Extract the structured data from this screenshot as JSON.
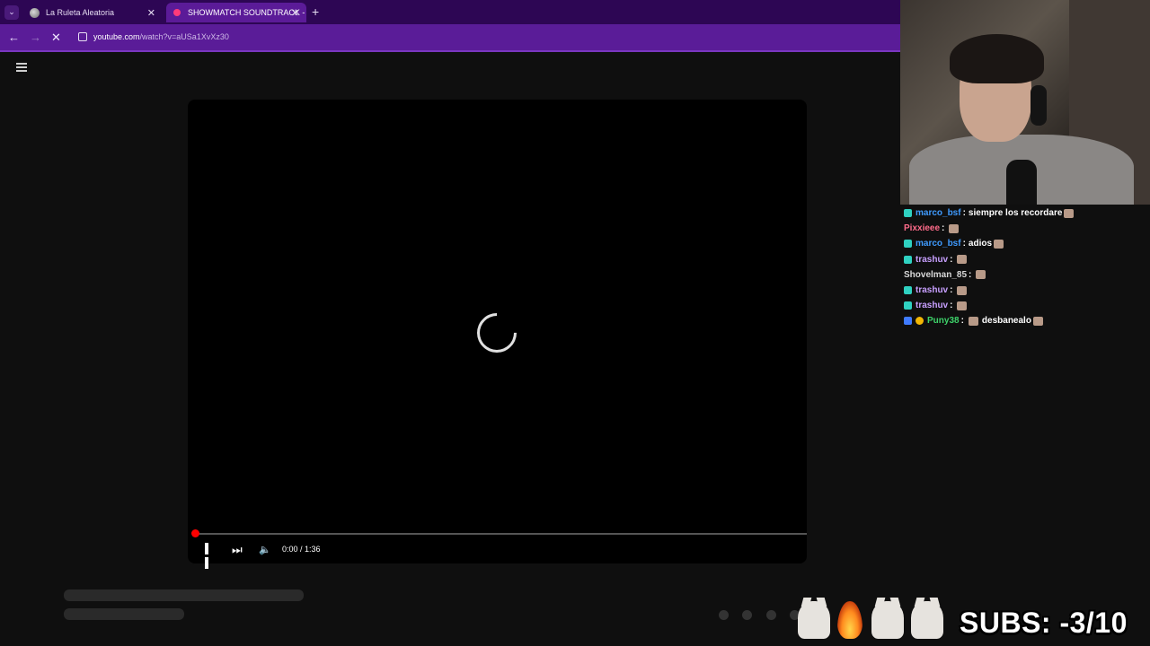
{
  "browser": {
    "tabs": [
      {
        "title": "La Ruleta Aleatoria",
        "active": false
      },
      {
        "title": "SHOWMATCH SOUNDTRACK -",
        "active": true
      }
    ],
    "url_host": "youtube.com",
    "url_path": "/watch?v=aUSa1XvXz30",
    "accent": "#5a1c98"
  },
  "player": {
    "time": "0:00 / 1:36",
    "progress_fraction": 0,
    "state": "loading"
  },
  "chat": [
    {
      "user": "marco_bsf",
      "message": "siempre los recordare",
      "color": "#3f9bff",
      "badges": [
        "teal"
      ]
    },
    {
      "user": "Pixxieee",
      "message": "",
      "color": "#ff6b8a",
      "badges": []
    },
    {
      "user": "marco_bsf",
      "message": "adios",
      "color": "#3f9bff",
      "badges": [
        "teal"
      ]
    },
    {
      "user": "trashuv",
      "message": "",
      "color": "#c8a0ff",
      "badges": [
        "teal"
      ]
    },
    {
      "user": "Shovelman_85",
      "message": "",
      "color": "#d9d9d9",
      "badges": []
    },
    {
      "user": "trashuv",
      "message": "",
      "color": "#c8a0ff",
      "badges": [
        "teal"
      ]
    },
    {
      "user": "trashuv",
      "message": "",
      "color": "#c8a0ff",
      "badges": [
        "teal"
      ]
    },
    {
      "user": "Puny38",
      "message": "desbanealo",
      "color": "#3ed36a",
      "badges": [
        "blue",
        "gold"
      ]
    }
  ],
  "overlay": {
    "subs": "SUBS: -3/10"
  }
}
